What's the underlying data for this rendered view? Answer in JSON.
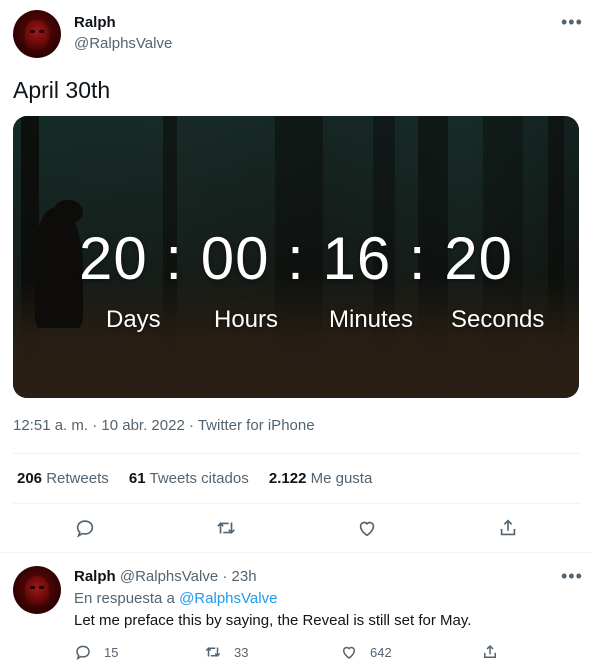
{
  "tweet": {
    "author_name": "Ralph",
    "author_handle": "@RalphsValve",
    "text": "April 30th",
    "more_icon": "more-icon",
    "media": {
      "countdown": {
        "days": "20",
        "hours": "00",
        "minutes": "16",
        "seconds": "20",
        "separator": ":",
        "labels": {
          "days": "Days",
          "hours": "Hours",
          "minutes": "Minutes",
          "seconds": "Seconds"
        }
      }
    },
    "timestamp": "12:51 a. m. · 10 abr. 2022 · Twitter for iPhone",
    "stats": {
      "retweets_count": "206",
      "retweets_label": "Retweets",
      "quotes_count": "61",
      "quotes_label": "Tweets citados",
      "likes_count": "2.122",
      "likes_label": "Me gusta"
    },
    "actions": [
      "reply-icon",
      "retweet-icon",
      "like-icon",
      "share-icon"
    ]
  },
  "reply": {
    "author_name": "Ralph",
    "author_handle": "@RalphsValve",
    "time": "· 23h",
    "in_reply_prefix": "En respuesta a",
    "in_reply_handle": "@RalphsValve",
    "text": "Let me preface this by saying, the Reveal is still set for May.",
    "reply_count": "15",
    "retweet_count": "33",
    "like_count": "642"
  },
  "colors": {
    "accent": "#1d9bf0",
    "text": "#0f1419",
    "muted": "#536471",
    "divider": "#eff3f4"
  }
}
